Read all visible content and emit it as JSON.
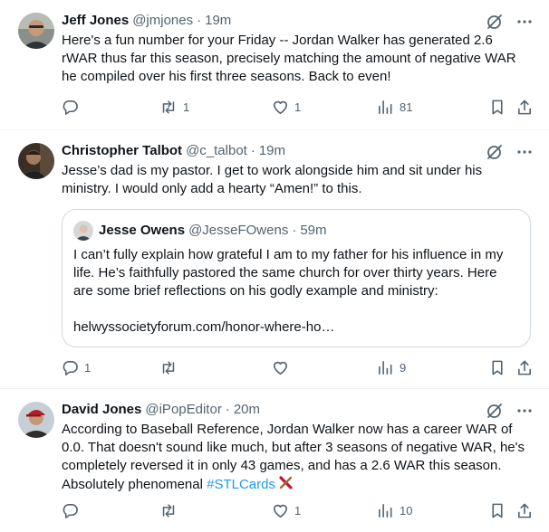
{
  "tweets": [
    {
      "name": "Jeff Jones",
      "handle": "@jmjones",
      "time": "19m",
      "text": "Here's a fun number for your Friday -- Jordan Walker has generated 2.6 rWAR thus far this season, precisely matching the amount of negative WAR he compiled over his first three seasons. Back to even!",
      "replies": "",
      "retweets": "1",
      "likes": "1",
      "views": "81"
    },
    {
      "name": "Christopher Talbot",
      "handle": "@c_talbot",
      "time": "19m",
      "text": "Jesse’s dad is my pastor. I get to work alongside him and sit under his ministry. I would only add a hearty “Amen!” to this.",
      "quote": {
        "name": "Jesse Owens",
        "handle": "@JesseFOwens",
        "time": "59m",
        "text": "I can’t fully explain how grateful I am to my father for his influence in my life. He’s faithfully pastored the same church for over thirty years. Here are some brief reflections on his godly example and ministry:",
        "link": "helwyssocietyforum.com/honor-where-ho…"
      },
      "replies": "1",
      "retweets": "",
      "likes": "",
      "views": "9"
    },
    {
      "name": "David Jones",
      "handle": "@iPopEditor",
      "time": "20m",
      "text_before": "According to Baseball Reference, Jordan Walker now has a career WAR of 0.0. That doesn't sound like much, but after 3 seasons of negative WAR, he's completely reversed it in only 43 games, and has a 2.6 WAR this season. Absolutely phenomenal ",
      "hashtag": "#STLCards",
      "replies": "",
      "retweets": "",
      "likes": "1",
      "views": "10"
    }
  ],
  "separator": "·",
  "colors": {
    "text": "#0f1419",
    "secondary": "#536471",
    "link": "#1d9bf0",
    "border": "#cfd9de",
    "divider": "#eff3f4"
  },
  "icons": [
    "grok-icon",
    "more-icon",
    "reply-icon",
    "retweet-icon",
    "like-icon",
    "views-icon",
    "bookmark-icon",
    "share-icon",
    "bat-emoji-icon"
  ]
}
